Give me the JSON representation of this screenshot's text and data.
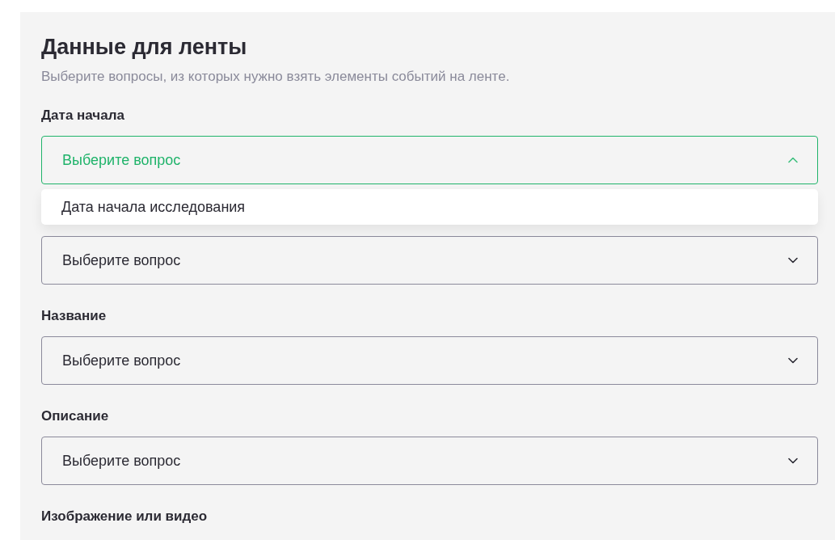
{
  "panel": {
    "title": "Данные для ленты",
    "subtitle": "Выберите вопросы, из которых нужно взять элементы событий на ленте."
  },
  "fields": [
    {
      "label": "Дата начала",
      "placeholder": "Выберите вопрос",
      "expanded": true,
      "options": [
        {
          "label": "Дата начала исследования"
        }
      ]
    },
    {
      "placeholder": "Выберите вопрос",
      "expanded": false
    },
    {
      "label": "Название",
      "placeholder": "Выберите вопрос",
      "expanded": false
    },
    {
      "label": "Описание",
      "placeholder": "Выберите вопрос",
      "expanded": false
    },
    {
      "label": "Изображение или видео"
    }
  ]
}
